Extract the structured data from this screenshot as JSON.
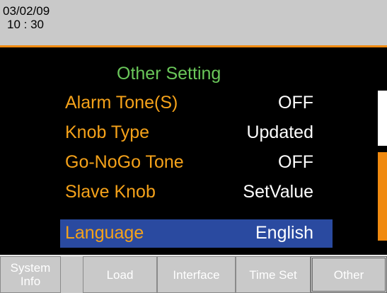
{
  "header": {
    "date": "03/02/09",
    "time": "10 : 30"
  },
  "screen": {
    "title": "Other Setting",
    "settings": [
      {
        "label": "Alarm Tone(S)",
        "value": "OFF"
      },
      {
        "label": "Knob Type",
        "value": "Updated"
      },
      {
        "label": "Go-NoGo Tone",
        "value": "OFF"
      },
      {
        "label": "Slave Knob",
        "value": "SetValue"
      },
      {
        "label": "Language",
        "value": "English",
        "selected": true
      }
    ]
  },
  "softkeys": {
    "system_info_line1": "System",
    "system_info_line2": "Info",
    "load": "Load",
    "interface": "Interface",
    "time_set": "Time Set",
    "other": "Other"
  },
  "colors": {
    "header_bg": "#c9c9c9",
    "accent_orange": "#f08a10",
    "label_orange": "#f5a21a",
    "title_green": "#6ac75a",
    "selection_blue": "#2a4aa0",
    "screen_bg": "#000000"
  }
}
